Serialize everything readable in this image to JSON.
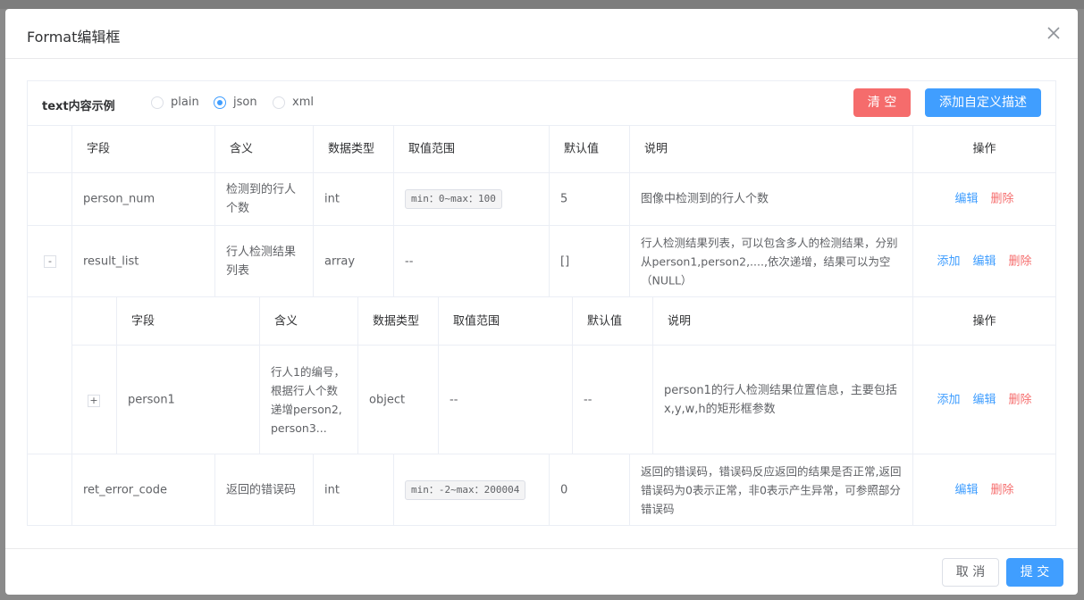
{
  "dialog": {
    "title": "Format编辑框"
  },
  "toolbar": {
    "label": "text内容示例",
    "radios": [
      {
        "label": "plain",
        "checked": false
      },
      {
        "label": "json",
        "checked": true
      },
      {
        "label": "xml",
        "checked": false
      }
    ],
    "clear_label": "清 空",
    "add_custom_label": "添加自定义描述"
  },
  "table": {
    "headers": [
      "字段",
      "含义",
      "数据类型",
      "取值范围",
      "默认值",
      "说明",
      "操作"
    ],
    "rows": [
      {
        "field": "person_num",
        "meaning": "检测到的行人个数",
        "type": "int",
        "range": "min：0~max：100",
        "default": "5",
        "desc": "图像中检测到的行人个数",
        "ops": {
          "edit": "编辑",
          "delete": "删除"
        }
      },
      {
        "toggle": "-",
        "field": "result_list",
        "meaning": "行人检测结果列表",
        "type": "array",
        "range": "--",
        "default": "[]",
        "desc": "行人检测结果列表，可以包含多人的检测结果，分别从person1,person2,....,依次递增，结果可以为空（NULL）",
        "ops": {
          "add": "添加",
          "edit": "编辑",
          "delete": "删除"
        }
      },
      {
        "field": "ret_error_code",
        "meaning": "返回的错误码",
        "type": "int",
        "range": "min：-2~max：200004",
        "default": "0",
        "desc": "返回的错误码，错误码反应返回的结果是否正常,返回错误码为0表示正常，非0表示产生异常，可参照部分错误码",
        "ops": {
          "edit": "编辑",
          "delete": "删除"
        }
      }
    ],
    "nested": {
      "headers": [
        "字段",
        "含义",
        "数据类型",
        "取值范围",
        "默认值",
        "说明",
        "操作"
      ],
      "row": {
        "toggle": "+",
        "field": "person1",
        "meaning": "行人1的编号，根据行人个数递增person2,person3...",
        "type": "object",
        "range": "--",
        "default": "--",
        "desc": "person1的行人检测结果位置信息，主要包括x,y,w,h的矩形框参数",
        "ops": {
          "add": "添加",
          "edit": "编辑",
          "delete": "删除"
        }
      }
    }
  },
  "footer": {
    "cancel_label": "取 消",
    "submit_label": "提 交"
  },
  "colors": {
    "primary": "#409eff",
    "danger": "#f56c6c",
    "border": "#ebeef5"
  }
}
